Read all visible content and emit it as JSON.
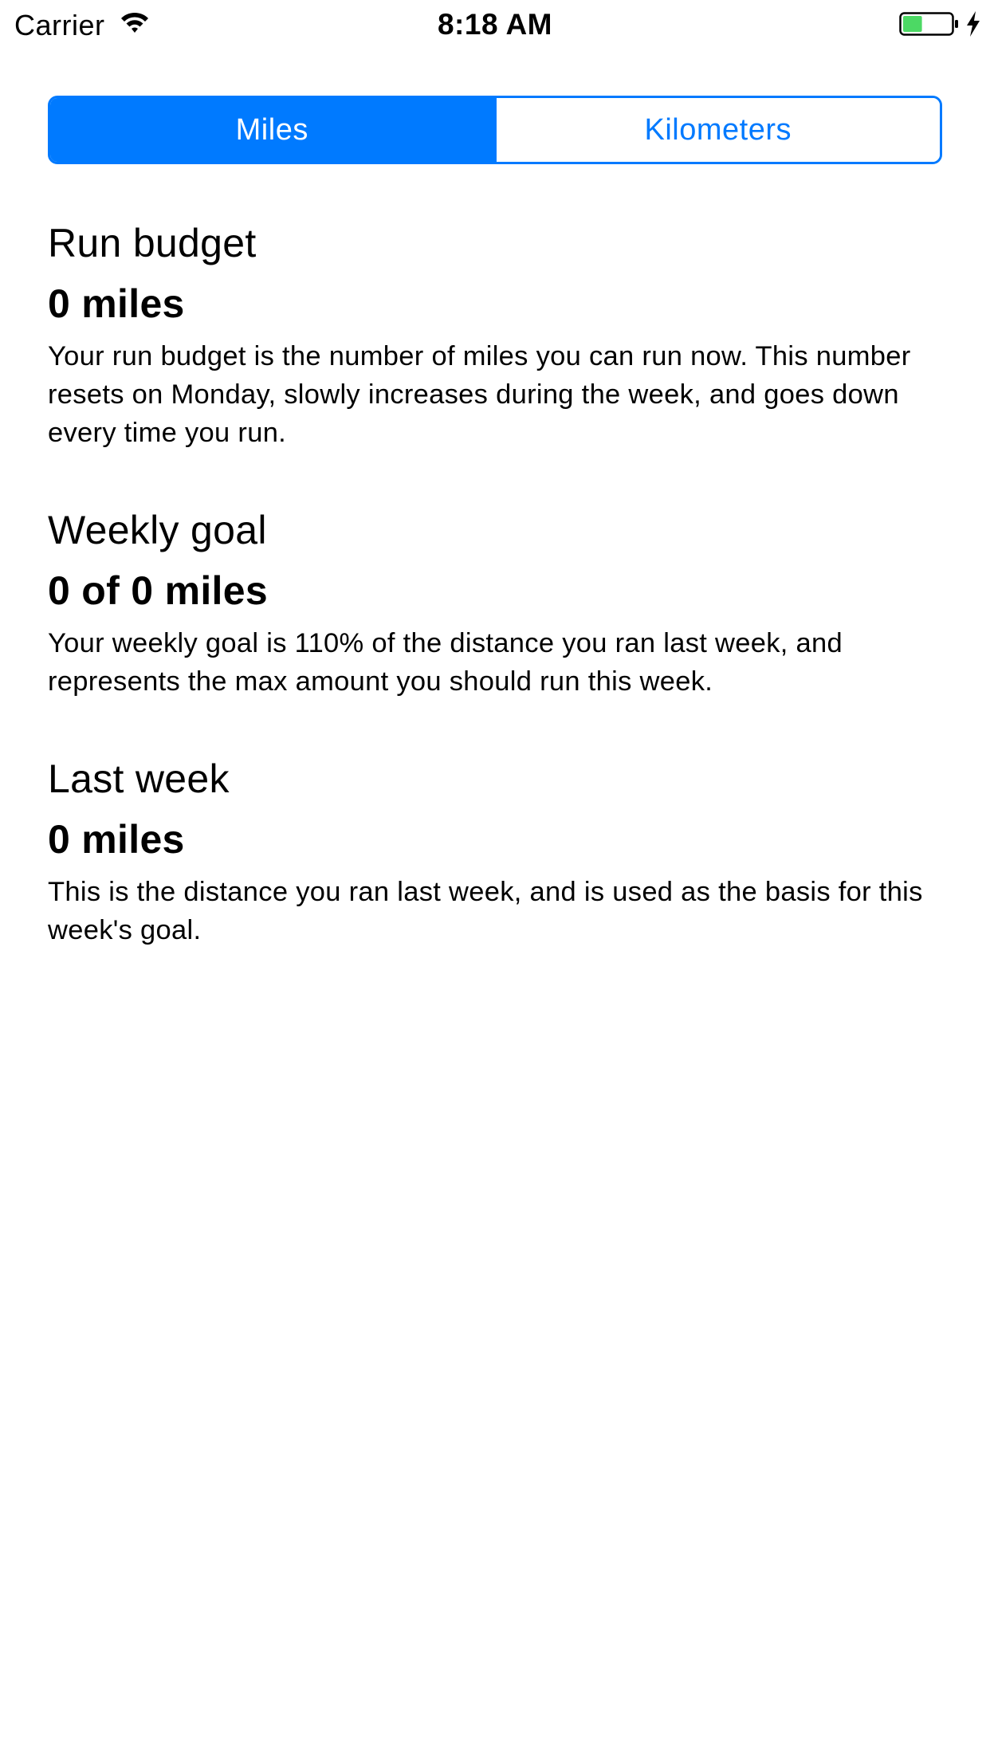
{
  "status_bar": {
    "carrier": "Carrier",
    "time": "8:18 AM",
    "battery_level": 0.4,
    "charging": true,
    "icons": [
      "wifi-icon",
      "battery-icon",
      "charging-icon"
    ]
  },
  "colors": {
    "accent": "#007aff",
    "battery_fill": "#4cd964"
  },
  "unit_selector": {
    "options": [
      "Miles",
      "Kilometers"
    ],
    "selected": "Miles"
  },
  "sections": {
    "run_budget": {
      "title": "Run budget",
      "value": "0 miles",
      "description": "Your run budget is the number of miles you can run now. This number resets on Monday, slowly increases during the week, and goes down every time you run."
    },
    "weekly_goal": {
      "title": "Weekly goal",
      "value": "0 of 0 miles",
      "description": "Your weekly goal is 110% of the distance you ran last week, and represents the max amount you should run this week."
    },
    "last_week": {
      "title": "Last week",
      "value": "0 miles",
      "description": "This is the distance you ran last week, and is used as the basis for this week's goal."
    }
  }
}
